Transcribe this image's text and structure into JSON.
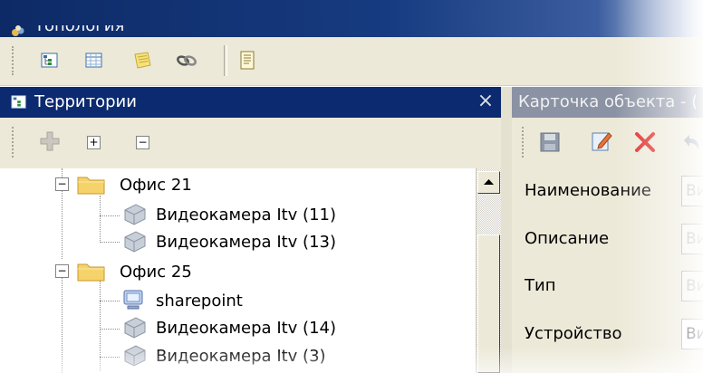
{
  "window": {
    "title": "Топология",
    "icon": "topology-app-icon"
  },
  "toolbar": {
    "buttons": [
      {
        "name": "territories-view-button",
        "icon": "tree-view-icon"
      },
      {
        "name": "grid-view-button",
        "icon": "grid-icon"
      },
      {
        "name": "notes-button",
        "icon": "notes-icon"
      },
      {
        "name": "link-button",
        "icon": "chain-link-icon"
      },
      {
        "name": "document-button",
        "icon": "document-icon"
      }
    ]
  },
  "territories": {
    "title": "Территории",
    "close_label": "×",
    "tools": {
      "add_icon": "add-icon",
      "expand_label": "+",
      "collapse_label": "−"
    },
    "tree": [
      {
        "label": "Офис 21",
        "type": "folder",
        "expanded": true,
        "expander": "−",
        "children": [
          {
            "label": "Видеокамера Itv (11)",
            "type": "camera"
          },
          {
            "label": "Видеокамера Itv (13)",
            "type": "camera"
          }
        ]
      },
      {
        "label": "Офис 25",
        "type": "folder",
        "expanded": true,
        "expander": "−",
        "children": [
          {
            "label": "sharepoint",
            "type": "computer"
          },
          {
            "label": "Видеокамера Itv (14)",
            "type": "camera"
          },
          {
            "label": "Видеокамера Itv (3)",
            "type": "camera"
          }
        ]
      }
    ]
  },
  "object_card": {
    "title": "Карточка объекта - (",
    "tools": [
      "save-icon",
      "edit-icon",
      "delete-icon",
      "undo-icon"
    ],
    "fields": [
      {
        "label": "Наименование",
        "value": "Ви"
      },
      {
        "label": "Описание",
        "value": "Ви"
      },
      {
        "label": "Тип",
        "value": "Ви"
      },
      {
        "label": "Устройство",
        "value": "Ви"
      }
    ]
  },
  "colors": {
    "titlebar": "#0d2a66",
    "panel_header": "#0b2a6f",
    "panel_bg": "#ece9d8",
    "inactive_header": "#8a92a4"
  }
}
